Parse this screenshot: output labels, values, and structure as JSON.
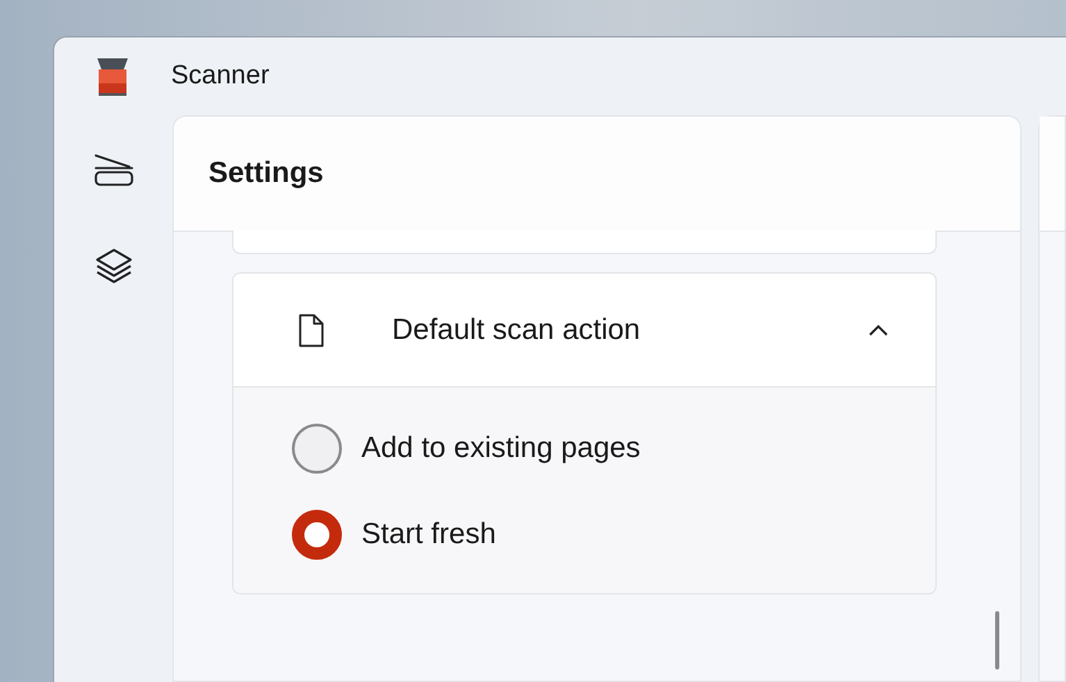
{
  "window": {
    "title": "Scanner"
  },
  "nav": [
    {
      "kind": "scanner"
    },
    {
      "kind": "layers"
    }
  ],
  "settings": {
    "title": "Settings",
    "expander": {
      "title": "Default scan action",
      "expanded": true,
      "options": [
        {
          "label": "Add to existing pages",
          "selected": false
        },
        {
          "label": "Start fresh",
          "selected": true
        }
      ]
    }
  }
}
